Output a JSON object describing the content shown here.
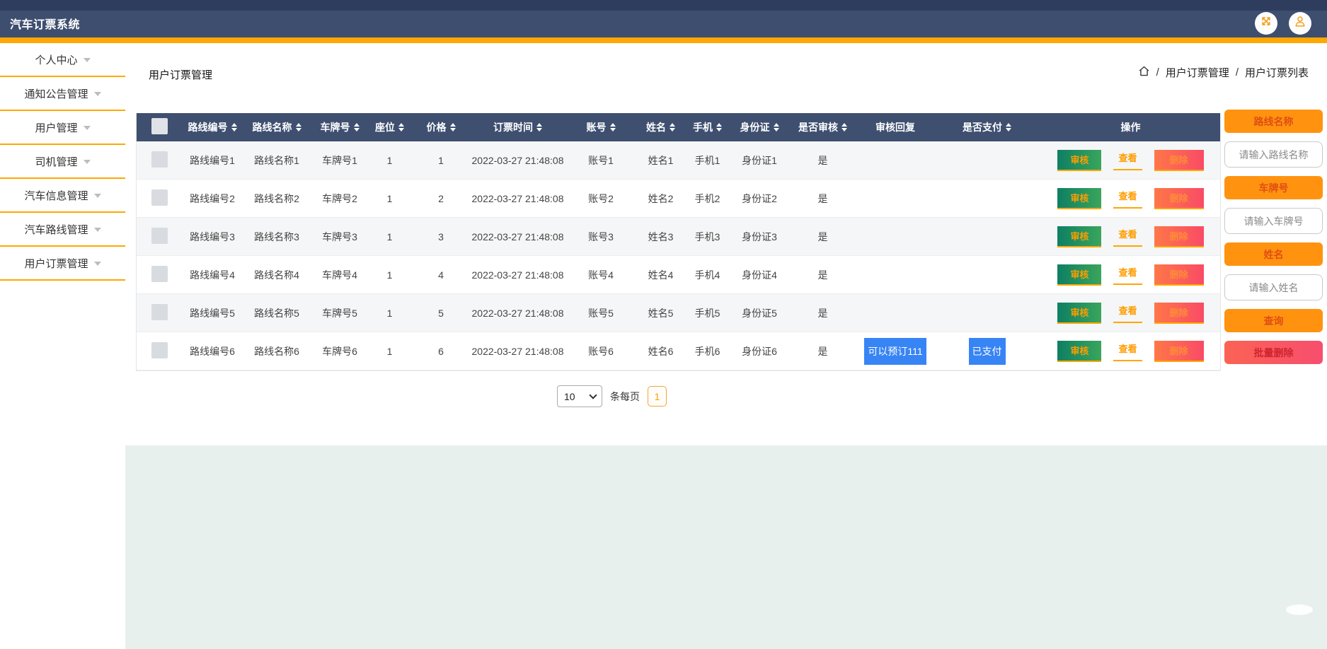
{
  "app": {
    "title": "汽车订票系统"
  },
  "topbar": {
    "icons": [
      {
        "name": "fullscreen"
      },
      {
        "name": "user"
      }
    ]
  },
  "sidebar": {
    "items": [
      {
        "label": "个人中心"
      },
      {
        "label": "通知公告管理"
      },
      {
        "label": "用户管理"
      },
      {
        "label": "司机管理"
      },
      {
        "label": "汽车信息管理"
      },
      {
        "label": "汽车路线管理"
      },
      {
        "label": "用户订票管理"
      }
    ]
  },
  "page": {
    "title": "用户订票管理"
  },
  "breadcrumb": {
    "separator": "/",
    "items": [
      "用户订票管理",
      "用户订票列表"
    ]
  },
  "table": {
    "columns": [
      {
        "label": "路线编号",
        "sortable": true
      },
      {
        "label": "路线名称",
        "sortable": true
      },
      {
        "label": "车牌号",
        "sortable": true
      },
      {
        "label": "座位",
        "sortable": true
      },
      {
        "label": "价格",
        "sortable": true
      },
      {
        "label": "订票时间",
        "sortable": true
      },
      {
        "label": "账号",
        "sortable": true
      },
      {
        "label": "姓名",
        "sortable": true
      },
      {
        "label": "手机",
        "sortable": true
      },
      {
        "label": "身份证",
        "sortable": true
      },
      {
        "label": "是否审核",
        "sortable": true
      },
      {
        "label": "审核回复",
        "sortable": false
      },
      {
        "label": "是否支付",
        "sortable": true
      },
      {
        "label": "操作",
        "sortable": false
      }
    ],
    "rows": [
      {
        "route_no": "路线编号1",
        "route_name": "路线名称1",
        "plate": "车牌号1",
        "seat": "1",
        "price": "1",
        "time": "2022-03-27 21:48:08",
        "account": "账号1",
        "name": "姓名1",
        "phone": "手机1",
        "id_card": "身份证1",
        "audited": "是",
        "reply": "",
        "paid": ""
      },
      {
        "route_no": "路线编号2",
        "route_name": "路线名称2",
        "plate": "车牌号2",
        "seat": "1",
        "price": "2",
        "time": "2022-03-27 21:48:08",
        "account": "账号2",
        "name": "姓名2",
        "phone": "手机2",
        "id_card": "身份证2",
        "audited": "是",
        "reply": "",
        "paid": ""
      },
      {
        "route_no": "路线编号3",
        "route_name": "路线名称3",
        "plate": "车牌号3",
        "seat": "1",
        "price": "3",
        "time": "2022-03-27 21:48:08",
        "account": "账号3",
        "name": "姓名3",
        "phone": "手机3",
        "id_card": "身份证3",
        "audited": "是",
        "reply": "",
        "paid": ""
      },
      {
        "route_no": "路线编号4",
        "route_name": "路线名称4",
        "plate": "车牌号4",
        "seat": "1",
        "price": "4",
        "time": "2022-03-27 21:48:08",
        "account": "账号4",
        "name": "姓名4",
        "phone": "手机4",
        "id_card": "身份证4",
        "audited": "是",
        "reply": "",
        "paid": ""
      },
      {
        "route_no": "路线编号5",
        "route_name": "路线名称5",
        "plate": "车牌号5",
        "seat": "1",
        "price": "5",
        "time": "2022-03-27 21:48:08",
        "account": "账号5",
        "name": "姓名5",
        "phone": "手机5",
        "id_card": "身份证5",
        "audited": "是",
        "reply": "",
        "paid": ""
      },
      {
        "route_no": "路线编号6",
        "route_name": "路线名称6",
        "plate": "车牌号6",
        "seat": "1",
        "price": "6",
        "time": "2022-03-27 21:48:08",
        "account": "账号6",
        "name": "姓名6",
        "phone": "手机6",
        "id_card": "身份证6",
        "audited": "是",
        "reply": "可以预订111",
        "paid": "已支付"
      }
    ],
    "ops": {
      "audit": "审核",
      "view": "查看",
      "del": "删除"
    }
  },
  "pagination": {
    "page_size": "10",
    "per_page_label": "条每页",
    "page": "1"
  },
  "filter_panel": {
    "groups": [
      {
        "button": "路线名称",
        "placeholder": "请输入路线名称"
      },
      {
        "button": "车牌号",
        "placeholder": "请输入车牌号"
      },
      {
        "button": "姓名",
        "placeholder": "请输入姓名"
      }
    ],
    "search_label": "查询",
    "batch_delete_label": "批量删除"
  },
  "colors": {
    "navbar": "#3e4e6f",
    "accent_orange": "#ffa702",
    "audit_green_start": "#0e7f63",
    "audit_green_end": "#3aa55c",
    "delete_red_start": "#ff7748",
    "delete_red_end": "#f94b66",
    "badge_blue": "#3784f5",
    "panel_orange": "#ff9310",
    "panel_red": "#f85a68",
    "link_orange": "#ff9d00",
    "footer_green": "#e8f0ed"
  }
}
